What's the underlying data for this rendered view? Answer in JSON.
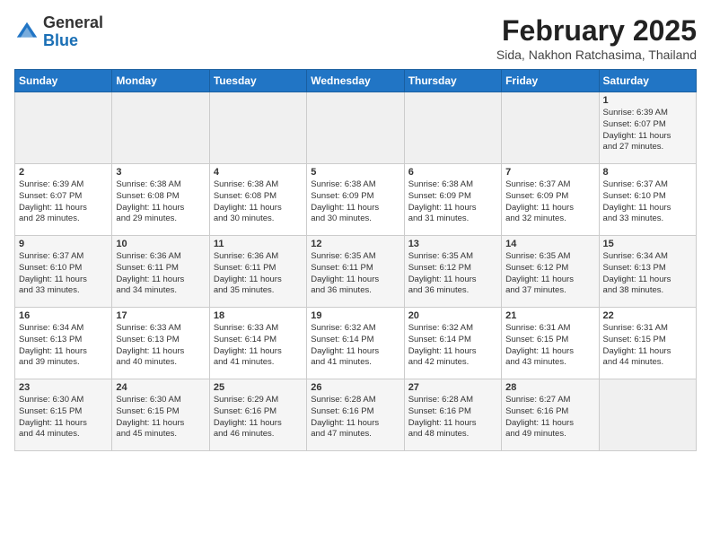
{
  "header": {
    "logo_general": "General",
    "logo_blue": "Blue",
    "month_title": "February 2025",
    "subtitle": "Sida, Nakhon Ratchasima, Thailand"
  },
  "days_of_week": [
    "Sunday",
    "Monday",
    "Tuesday",
    "Wednesday",
    "Thursday",
    "Friday",
    "Saturday"
  ],
  "weeks": [
    [
      {
        "day": "",
        "info": ""
      },
      {
        "day": "",
        "info": ""
      },
      {
        "day": "",
        "info": ""
      },
      {
        "day": "",
        "info": ""
      },
      {
        "day": "",
        "info": ""
      },
      {
        "day": "",
        "info": ""
      },
      {
        "day": "1",
        "info": "Sunrise: 6:39 AM\nSunset: 6:07 PM\nDaylight: 11 hours\nand 27 minutes."
      }
    ],
    [
      {
        "day": "2",
        "info": "Sunrise: 6:39 AM\nSunset: 6:07 PM\nDaylight: 11 hours\nand 28 minutes."
      },
      {
        "day": "3",
        "info": "Sunrise: 6:38 AM\nSunset: 6:08 PM\nDaylight: 11 hours\nand 29 minutes."
      },
      {
        "day": "4",
        "info": "Sunrise: 6:38 AM\nSunset: 6:08 PM\nDaylight: 11 hours\nand 30 minutes."
      },
      {
        "day": "5",
        "info": "Sunrise: 6:38 AM\nSunset: 6:09 PM\nDaylight: 11 hours\nand 30 minutes."
      },
      {
        "day": "6",
        "info": "Sunrise: 6:38 AM\nSunset: 6:09 PM\nDaylight: 11 hours\nand 31 minutes."
      },
      {
        "day": "7",
        "info": "Sunrise: 6:37 AM\nSunset: 6:09 PM\nDaylight: 11 hours\nand 32 minutes."
      },
      {
        "day": "8",
        "info": "Sunrise: 6:37 AM\nSunset: 6:10 PM\nDaylight: 11 hours\nand 33 minutes."
      }
    ],
    [
      {
        "day": "9",
        "info": "Sunrise: 6:37 AM\nSunset: 6:10 PM\nDaylight: 11 hours\nand 33 minutes."
      },
      {
        "day": "10",
        "info": "Sunrise: 6:36 AM\nSunset: 6:11 PM\nDaylight: 11 hours\nand 34 minutes."
      },
      {
        "day": "11",
        "info": "Sunrise: 6:36 AM\nSunset: 6:11 PM\nDaylight: 11 hours\nand 35 minutes."
      },
      {
        "day": "12",
        "info": "Sunrise: 6:35 AM\nSunset: 6:11 PM\nDaylight: 11 hours\nand 36 minutes."
      },
      {
        "day": "13",
        "info": "Sunrise: 6:35 AM\nSunset: 6:12 PM\nDaylight: 11 hours\nand 36 minutes."
      },
      {
        "day": "14",
        "info": "Sunrise: 6:35 AM\nSunset: 6:12 PM\nDaylight: 11 hours\nand 37 minutes."
      },
      {
        "day": "15",
        "info": "Sunrise: 6:34 AM\nSunset: 6:13 PM\nDaylight: 11 hours\nand 38 minutes."
      }
    ],
    [
      {
        "day": "16",
        "info": "Sunrise: 6:34 AM\nSunset: 6:13 PM\nDaylight: 11 hours\nand 39 minutes."
      },
      {
        "day": "17",
        "info": "Sunrise: 6:33 AM\nSunset: 6:13 PM\nDaylight: 11 hours\nand 40 minutes."
      },
      {
        "day": "18",
        "info": "Sunrise: 6:33 AM\nSunset: 6:14 PM\nDaylight: 11 hours\nand 41 minutes."
      },
      {
        "day": "19",
        "info": "Sunrise: 6:32 AM\nSunset: 6:14 PM\nDaylight: 11 hours\nand 41 minutes."
      },
      {
        "day": "20",
        "info": "Sunrise: 6:32 AM\nSunset: 6:14 PM\nDaylight: 11 hours\nand 42 minutes."
      },
      {
        "day": "21",
        "info": "Sunrise: 6:31 AM\nSunset: 6:15 PM\nDaylight: 11 hours\nand 43 minutes."
      },
      {
        "day": "22",
        "info": "Sunrise: 6:31 AM\nSunset: 6:15 PM\nDaylight: 11 hours\nand 44 minutes."
      }
    ],
    [
      {
        "day": "23",
        "info": "Sunrise: 6:30 AM\nSunset: 6:15 PM\nDaylight: 11 hours\nand 44 minutes."
      },
      {
        "day": "24",
        "info": "Sunrise: 6:30 AM\nSunset: 6:15 PM\nDaylight: 11 hours\nand 45 minutes."
      },
      {
        "day": "25",
        "info": "Sunrise: 6:29 AM\nSunset: 6:16 PM\nDaylight: 11 hours\nand 46 minutes."
      },
      {
        "day": "26",
        "info": "Sunrise: 6:28 AM\nSunset: 6:16 PM\nDaylight: 11 hours\nand 47 minutes."
      },
      {
        "day": "27",
        "info": "Sunrise: 6:28 AM\nSunset: 6:16 PM\nDaylight: 11 hours\nand 48 minutes."
      },
      {
        "day": "28",
        "info": "Sunrise: 6:27 AM\nSunset: 6:16 PM\nDaylight: 11 hours\nand 49 minutes."
      },
      {
        "day": "",
        "info": ""
      }
    ]
  ]
}
